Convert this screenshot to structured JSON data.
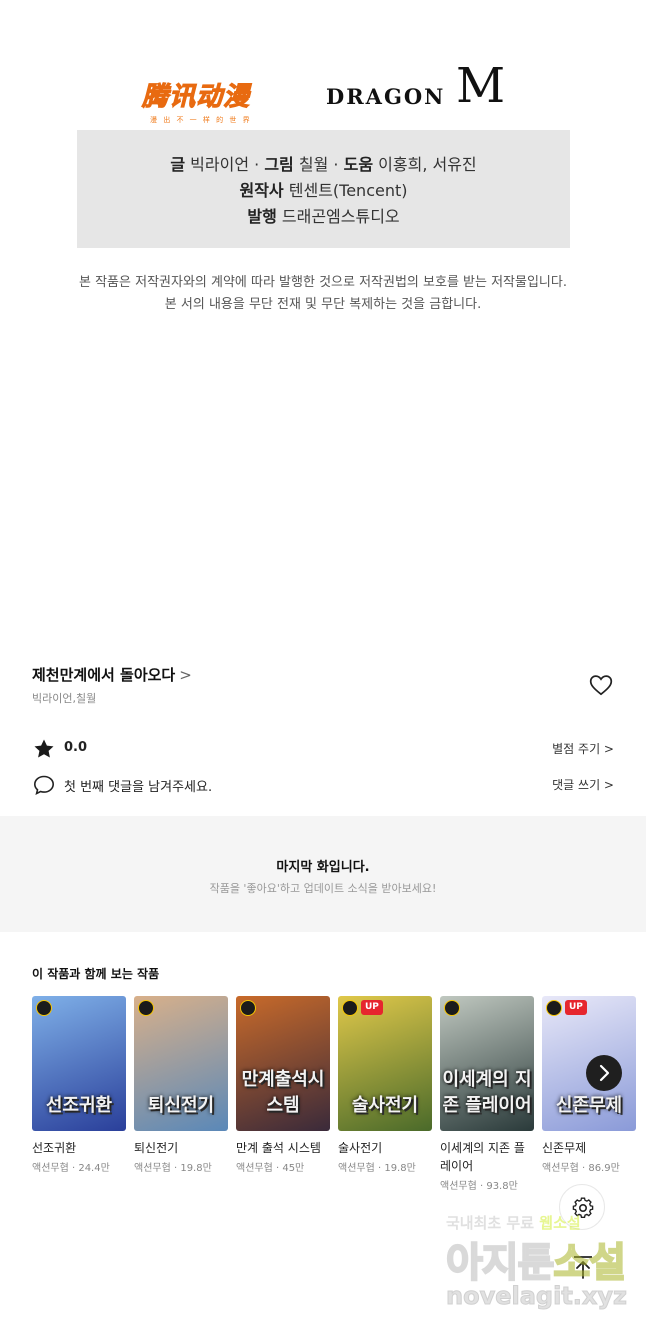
{
  "logos": {
    "tencent_mark": "腾讯动漫",
    "tencent_sub": "漫 出 不 一 样 的 世 界",
    "dragon_text": "DRAGON",
    "dragon_m": "M"
  },
  "credits": {
    "writer_label": "글",
    "writer": "빅라이언",
    "art_label": "그림",
    "art": "칠월",
    "assist_label": "도움",
    "assist": "이홍희, 서유진",
    "original_label": "원작사",
    "original": "텐센트(Tencent)",
    "publisher_label": "발행",
    "publisher": "드래곤엠스튜디오",
    "sep": "·"
  },
  "copyright": {
    "line1": "본 작품은 저작권자와의 계약에 따라 발행한 것으로 저작권법의 보호를 받는 저작물입니다.",
    "line2": "본 서의 내용을 무단 전재 및 무단 복제하는 것을 금합니다."
  },
  "series": {
    "title": "제천만계에서 돌아오다",
    "chevron": ">",
    "authors": "빅라이언,칠월"
  },
  "rating": {
    "value": "0.0",
    "action": "별점 주기 >"
  },
  "comment": {
    "prompt": "첫 번째 댓글을 남겨주세요.",
    "action": "댓글 쓰기 >"
  },
  "last_episode": {
    "title": "마지막 화입니다.",
    "subtitle": "작품을 '좋아요'하고 업데이트 소식을 받아보세요!"
  },
  "recommend": {
    "title": "이 작품과 함께 보는 작품",
    "items": [
      {
        "name": "선조귀환",
        "meta": "액션무협 · 24.4만",
        "cover_text": "선조귀환",
        "badge_up": "",
        "color_a": "#2a3f9a",
        "color_b": "#7fb0e8"
      },
      {
        "name": "퇴신전기",
        "meta": "액션무협 · 19.8만",
        "cover_text": "퇴신전기",
        "badge_up": "",
        "color_a": "#5a88b8",
        "color_b": "#d8b08a"
      },
      {
        "name": "만계 출석 시스템",
        "meta": "액션무협 · 45만",
        "cover_text": "만계출석시스템",
        "badge_up": "",
        "color_a": "#3a2a3a",
        "color_b": "#c86a2a"
      },
      {
        "name": "술사전기",
        "meta": "액션무협 · 19.8만",
        "cover_text": "술사전기",
        "badge_up": "UP",
        "color_a": "#4a6a2a",
        "color_b": "#e0c84a"
      },
      {
        "name": "이세계의 지존 플레이어",
        "meta": "액션무협 · 93.8만",
        "cover_text": "이세계의 지존 플레이어",
        "badge_up": "",
        "color_a": "#2a3a3a",
        "color_b": "#c0c8c0"
      },
      {
        "name": "신존무제",
        "meta": "액션무협 · 86.9만",
        "cover_text": "신존무제",
        "badge_up": "UP",
        "color_a": "#8a9ad8",
        "color_b": "#e8e8f8"
      }
    ]
  },
  "watermark": {
    "line1_a": "국내최초 무료",
    "line1_b": "웹소설",
    "line2_a": "아지툰",
    "line2_b": "소설",
    "line3": "novelagit.xyz"
  },
  "colors": {
    "accent_orange": "#f07a1a",
    "up_badge": "#e6262e",
    "panel_gray": "#f5f5f5"
  }
}
